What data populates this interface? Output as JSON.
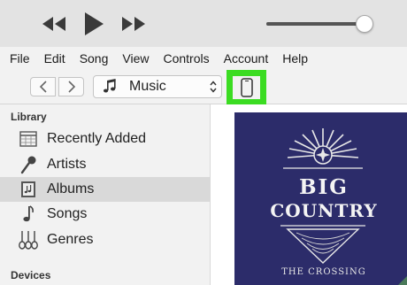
{
  "player": {
    "prev_icon": "rewind-icon",
    "play_icon": "play-icon",
    "next_icon": "fast-forward-icon",
    "volume_level": 0.98
  },
  "menu": {
    "items": [
      "File",
      "Edit",
      "Song",
      "View",
      "Controls",
      "Account",
      "Help"
    ]
  },
  "toolbar": {
    "back_icon": "chevron-left-icon",
    "forward_icon": "chevron-right-icon",
    "media_type": "Music",
    "media_icon": "music-note-icon",
    "device_icon": "iphone-icon",
    "highlight_color": "#3bdc22"
  },
  "sidebar": {
    "library_heading": "Library",
    "items": [
      {
        "label": "Recently Added",
        "icon": "calendar-grid-icon",
        "selected": false
      },
      {
        "label": "Artists",
        "icon": "microphone-icon",
        "selected": false
      },
      {
        "label": "Albums",
        "icon": "album-icon",
        "selected": true
      },
      {
        "label": "Songs",
        "icon": "music-note-icon",
        "selected": false
      },
      {
        "label": "Genres",
        "icon": "guitar-icon",
        "selected": false
      }
    ],
    "devices_heading": "Devices"
  },
  "album": {
    "line1": "BIG",
    "line2": "COUNTRY",
    "subtitle": "THE CROSSING",
    "cover_color": "#2c2c6a"
  }
}
